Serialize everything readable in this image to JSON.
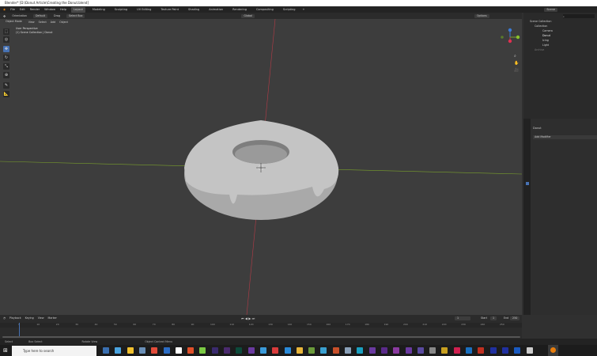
{
  "window": {
    "title": "Blender* [D:\\Donut Article\\Creating the Donut.blend]"
  },
  "menu": [
    "File",
    "Edit",
    "Render",
    "Window",
    "Help"
  ],
  "workspaces": [
    "Layout",
    "Modeling",
    "Sculpting",
    "UV Editing",
    "Texture Paint",
    "Shading",
    "Animation",
    "Rendering",
    "Compositing",
    "Scripting"
  ],
  "active_workspace": "Layout",
  "tool_header": {
    "orientation": "Orientation",
    "orientation_value": "Default",
    "drag_label": "Drag",
    "drag_value": "Select Box",
    "transform": "Global",
    "options": "Options"
  },
  "viewport_header": {
    "mode": "Object Mode",
    "items": [
      "View",
      "Select",
      "Add",
      "Object"
    ]
  },
  "viewport_info": {
    "line1": "User Perspective",
    "line2": "(1) Scene Collection | Donut"
  },
  "outliner": {
    "scene": "Scene",
    "view_layer": "ViewLayer",
    "items": [
      {
        "label": "Scene Collection"
      },
      {
        "label": "Collection"
      },
      {
        "label": "Camera"
      },
      {
        "label": "Donut"
      },
      {
        "label": "Icing"
      },
      {
        "label": "Light"
      },
      {
        "label": "Archive"
      }
    ]
  },
  "properties": {
    "object": "Donut",
    "add_modifier": "Add Modifier"
  },
  "timeline": {
    "menus": [
      "Playback",
      "Keying",
      "View",
      "Marker"
    ],
    "current_frame": "1",
    "start_label": "Start",
    "start": "1",
    "end_label": "End",
    "end": "250",
    "ticks": [
      "1",
      "10",
      "20",
      "30",
      "40",
      "50",
      "60",
      "70",
      "80",
      "90",
      "100",
      "110",
      "120",
      "130",
      "140",
      "150",
      "160",
      "170",
      "180",
      "190",
      "200",
      "210",
      "220",
      "230",
      "240",
      "250"
    ]
  },
  "statusbar": [
    "Select",
    "Box Select",
    "Rotate View",
    "Object Context Menu"
  ],
  "taskbar": {
    "search_placeholder": "Type here to search"
  },
  "colors": {
    "viewport": "#3d3d3d",
    "x_axis": "#b53b47",
    "y_axis": "#7aa02c",
    "donut": "#bdbdbd",
    "playhead": "#4772b3"
  }
}
